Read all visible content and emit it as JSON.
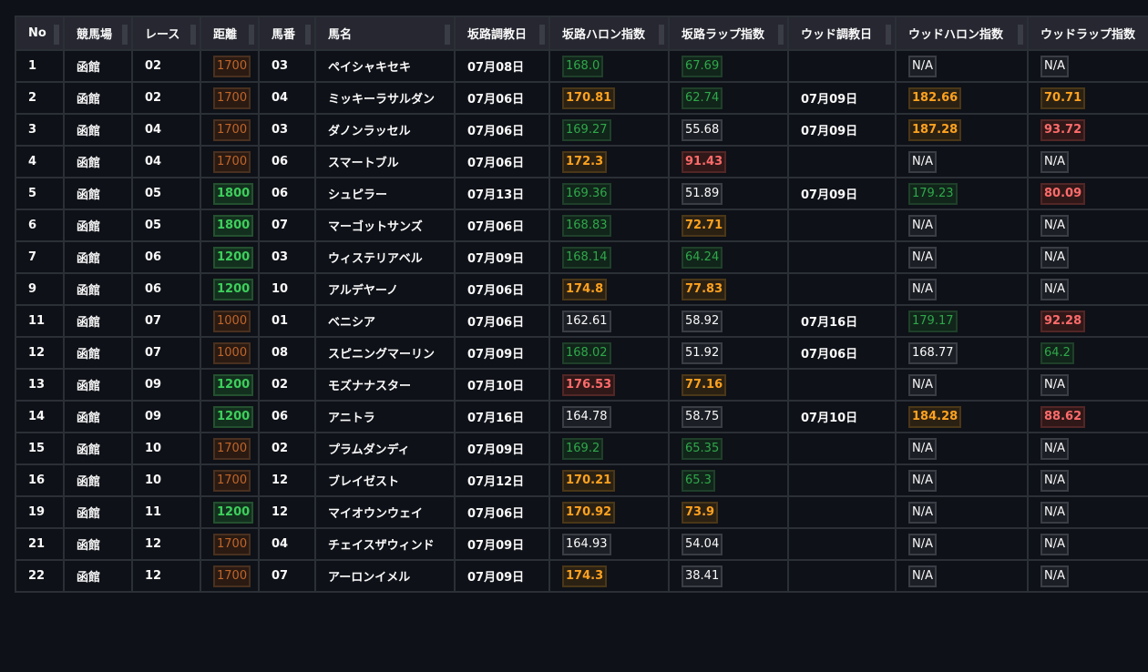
{
  "headers": [
    "No",
    "競馬場",
    "レース",
    "距離",
    "馬番",
    "馬名",
    "坂路調教日",
    "坂路ハロン指数",
    "坂路ラップ指数",
    "ウッド調教日",
    "ウッドハロン指数",
    "ウッドラップ指数"
  ],
  "rows": [
    {
      "no": "1",
      "place": "函館",
      "race": "02",
      "dist": "1700",
      "dist_c": "orange-dim",
      "num": "03",
      "name": "ペイシャキセキ",
      "sdate": "07月08日",
      "shal": "168.0",
      "shal_c": "green-dim",
      "slap": "67.69",
      "slap_c": "green-dim",
      "wdate": "",
      "whal": "N/A",
      "whal_c": "na",
      "wlap": "N/A",
      "wlap_c": "na"
    },
    {
      "no": "2",
      "place": "函館",
      "race": "02",
      "dist": "1700",
      "dist_c": "orange-dim",
      "num": "04",
      "name": "ミッキーラサルダン",
      "sdate": "07月06日",
      "shal": "170.81",
      "shal_c": "gold",
      "slap": "62.74",
      "slap_c": "green-dim",
      "wdate": "07月09日",
      "whal": "182.66",
      "whal_c": "gold",
      "wlap": "70.71",
      "wlap_c": "gold"
    },
    {
      "no": "3",
      "place": "函館",
      "race": "04",
      "dist": "1700",
      "dist_c": "orange-dim",
      "num": "03",
      "name": "ダノンラッセル",
      "sdate": "07月06日",
      "shal": "169.27",
      "shal_c": "green-dim",
      "slap": "55.68",
      "slap_c": "plain",
      "wdate": "07月09日",
      "whal": "187.28",
      "whal_c": "gold",
      "wlap": "93.72",
      "wlap_c": "red"
    },
    {
      "no": "4",
      "place": "函館",
      "race": "04",
      "dist": "1700",
      "dist_c": "orange-dim",
      "num": "06",
      "name": "スマートブル",
      "sdate": "07月06日",
      "shal": "172.3",
      "shal_c": "gold",
      "slap": "91.43",
      "slap_c": "red",
      "wdate": "",
      "whal": "N/A",
      "whal_c": "na",
      "wlap": "N/A",
      "wlap_c": "na"
    },
    {
      "no": "5",
      "place": "函館",
      "race": "05",
      "dist": "1800",
      "dist_c": "green",
      "num": "06",
      "name": "シュピラー",
      "sdate": "07月13日",
      "shal": "169.36",
      "shal_c": "green-dim",
      "slap": "51.89",
      "slap_c": "plain",
      "wdate": "07月09日",
      "whal": "179.23",
      "whal_c": "green-dim",
      "wlap": "80.09",
      "wlap_c": "red"
    },
    {
      "no": "6",
      "place": "函館",
      "race": "05",
      "dist": "1800",
      "dist_c": "green",
      "num": "07",
      "name": "マーゴットサンズ",
      "sdate": "07月06日",
      "shal": "168.83",
      "shal_c": "green-dim",
      "slap": "72.71",
      "slap_c": "gold",
      "wdate": "",
      "whal": "N/A",
      "whal_c": "na",
      "wlap": "N/A",
      "wlap_c": "na"
    },
    {
      "no": "7",
      "place": "函館",
      "race": "06",
      "dist": "1200",
      "dist_c": "green",
      "num": "03",
      "name": "ウィステリアベル",
      "sdate": "07月09日",
      "shal": "168.14",
      "shal_c": "green-dim",
      "slap": "64.24",
      "slap_c": "green-dim",
      "wdate": "",
      "whal": "N/A",
      "whal_c": "na",
      "wlap": "N/A",
      "wlap_c": "na"
    },
    {
      "no": "9",
      "place": "函館",
      "race": "06",
      "dist": "1200",
      "dist_c": "green",
      "num": "10",
      "name": "アルデヤーノ",
      "sdate": "07月06日",
      "shal": "174.8",
      "shal_c": "gold",
      "slap": "77.83",
      "slap_c": "gold",
      "wdate": "",
      "whal": "N/A",
      "whal_c": "na",
      "wlap": "N/A",
      "wlap_c": "na"
    },
    {
      "no": "11",
      "place": "函館",
      "race": "07",
      "dist": "1000",
      "dist_c": "orange-dim",
      "num": "01",
      "name": "ベニシア",
      "sdate": "07月06日",
      "shal": "162.61",
      "shal_c": "plain",
      "slap": "58.92",
      "slap_c": "plain",
      "wdate": "07月16日",
      "whal": "179.17",
      "whal_c": "green-dim",
      "wlap": "92.28",
      "wlap_c": "red"
    },
    {
      "no": "12",
      "place": "函館",
      "race": "07",
      "dist": "1000",
      "dist_c": "orange-dim",
      "num": "08",
      "name": "スピニングマーリン",
      "sdate": "07月09日",
      "shal": "168.02",
      "shal_c": "green-dim",
      "slap": "51.92",
      "slap_c": "plain",
      "wdate": "07月06日",
      "whal": "168.77",
      "whal_c": "plain",
      "wlap": "64.2",
      "wlap_c": "green-dim"
    },
    {
      "no": "13",
      "place": "函館",
      "race": "09",
      "dist": "1200",
      "dist_c": "green",
      "num": "02",
      "name": "モズナナスター",
      "sdate": "07月10日",
      "shal": "176.53",
      "shal_c": "red",
      "slap": "77.16",
      "slap_c": "gold",
      "wdate": "",
      "whal": "N/A",
      "whal_c": "na",
      "wlap": "N/A",
      "wlap_c": "na"
    },
    {
      "no": "14",
      "place": "函館",
      "race": "09",
      "dist": "1200",
      "dist_c": "green",
      "num": "06",
      "name": "アニトラ",
      "sdate": "07月16日",
      "shal": "164.78",
      "shal_c": "plain",
      "slap": "58.75",
      "slap_c": "plain",
      "wdate": "07月10日",
      "whal": "184.28",
      "whal_c": "gold",
      "wlap": "88.62",
      "wlap_c": "red"
    },
    {
      "no": "15",
      "place": "函館",
      "race": "10",
      "dist": "1700",
      "dist_c": "orange-dim",
      "num": "02",
      "name": "プラムダンディ",
      "sdate": "07月09日",
      "shal": "169.2",
      "shal_c": "green-dim",
      "slap": "65.35",
      "slap_c": "green-dim",
      "wdate": "",
      "whal": "N/A",
      "whal_c": "na",
      "wlap": "N/A",
      "wlap_c": "na"
    },
    {
      "no": "16",
      "place": "函館",
      "race": "10",
      "dist": "1700",
      "dist_c": "orange-dim",
      "num": "12",
      "name": "ブレイゼスト",
      "sdate": "07月12日",
      "shal": "170.21",
      "shal_c": "gold",
      "slap": "65.3",
      "slap_c": "green-dim",
      "wdate": "",
      "whal": "N/A",
      "whal_c": "na",
      "wlap": "N/A",
      "wlap_c": "na"
    },
    {
      "no": "19",
      "place": "函館",
      "race": "11",
      "dist": "1200",
      "dist_c": "green",
      "num": "12",
      "name": "マイオウンウェイ",
      "sdate": "07月06日",
      "shal": "170.92",
      "shal_c": "gold",
      "slap": "73.9",
      "slap_c": "gold",
      "wdate": "",
      "whal": "N/A",
      "whal_c": "na",
      "wlap": "N/A",
      "wlap_c": "na"
    },
    {
      "no": "21",
      "place": "函館",
      "race": "12",
      "dist": "1700",
      "dist_c": "orange-dim",
      "num": "04",
      "name": "チェイスザウィンド",
      "sdate": "07月09日",
      "shal": "164.93",
      "shal_c": "plain",
      "slap": "54.04",
      "slap_c": "plain",
      "wdate": "",
      "whal": "N/A",
      "whal_c": "na",
      "wlap": "N/A",
      "wlap_c": "na"
    },
    {
      "no": "22",
      "place": "函館",
      "race": "12",
      "dist": "1700",
      "dist_c": "orange-dim",
      "num": "07",
      "name": "アーロンイメル",
      "sdate": "07月09日",
      "shal": "174.3",
      "shal_c": "gold",
      "slap": "38.41",
      "slap_c": "plain",
      "wdate": "",
      "whal": "N/A",
      "whal_c": "na",
      "wlap": "N/A",
      "wlap_c": "na"
    }
  ],
  "colors": {
    "background": "#0e1117",
    "header_bg": "#262730",
    "grid": "#2b2f36",
    "gold": "#ffa21f",
    "red": "#ff6b6b",
    "green": "#3ecf5c",
    "green_dim": "#2fa84a",
    "orange_dim": "#c0652a"
  }
}
